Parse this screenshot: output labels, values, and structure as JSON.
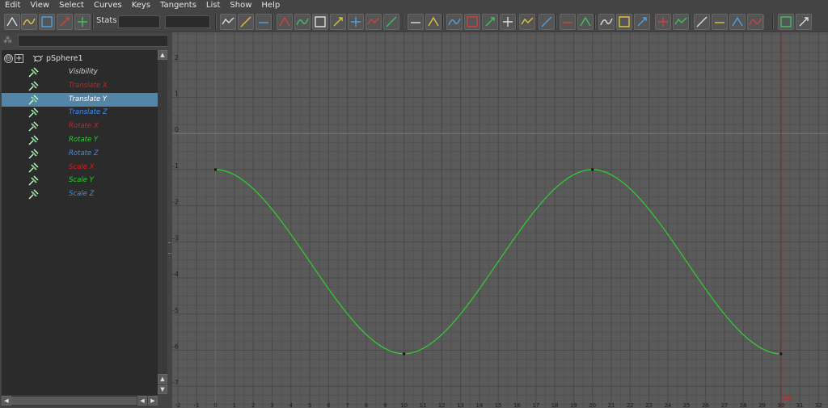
{
  "menubar": {
    "items": [
      "Edit",
      "View",
      "Select",
      "Curves",
      "Keys",
      "Tangents",
      "List",
      "Show",
      "Help"
    ]
  },
  "toolbar": {
    "stats_label": "Stats",
    "tool_icons": [
      "move-key-icon",
      "insert-key-icon",
      "lattice-deform-icon",
      "region-scale-icon",
      "retime-icon",
      "frame-all-icon",
      "frame-playback-range-icon",
      "center-current-time-icon",
      "auto-tangent-icon",
      "spline-tangent-icon",
      "clamped-tangent-icon",
      "linear-tangent-icon",
      "flat-tangent-icon",
      "step-tangent-icon",
      "plateau-tangent-icon",
      "break-tangents-icon",
      "unify-tangents-icon",
      "free-tangent-weight-icon",
      "lock-tangent-weight-icon",
      "weighted-tangents-icon",
      "buffer-curve-snapshot-icon",
      "swap-buffer-curve-icon",
      "auto-load-icon",
      "load-selected-icon",
      "normalize-icon",
      "denormalize-icon",
      "pre-infinity-icon",
      "post-infinity-icon",
      "cycle-icon",
      "cycle-offset-icon",
      "oscillate-icon",
      "linear-infinity-icon",
      "constant-infinity-icon",
      "curve-editor-icon",
      "dope-sheet-icon",
      "trax-editor-icon"
    ]
  },
  "outliner": {
    "root": {
      "name": "pSphere1",
      "expander": "⊖",
      "plus": "+"
    },
    "channels": [
      {
        "label": "Visibility",
        "color": "#d8d8d8"
      },
      {
        "label": "Translate X",
        "color": "#d42020"
      },
      {
        "label": "Translate Y",
        "color": "#ffffff"
      },
      {
        "label": "Translate Z",
        "color": "#3f8cf0"
      },
      {
        "label": "Rotate X",
        "color": "#d42020"
      },
      {
        "label": "Rotate Y",
        "color": "#27d127"
      },
      {
        "label": "Rotate Z",
        "color": "#3f8cf0"
      },
      {
        "label": "Scale X",
        "color": "#d42020"
      },
      {
        "label": "Scale Y",
        "color": "#27d127"
      },
      {
        "label": "Scale Z",
        "color": "#3f8cf0"
      }
    ],
    "selected_channel": "Translate Y",
    "selection_color": "#5285a6"
  },
  "graph_editor": {
    "background": "#5a5a5a",
    "curve_color": "#2fd12f",
    "time_marker_color": "#c01010",
    "current_frame": "30",
    "x_tick_labels": [
      "-2",
      "-1",
      "0",
      "1",
      "2",
      "3",
      "4",
      "5",
      "6",
      "7",
      "8",
      "9",
      "10",
      "11",
      "12",
      "13",
      "14",
      "15",
      "16",
      "17",
      "18",
      "19",
      "20",
      "21",
      "22",
      "23",
      "24",
      "25",
      "26",
      "27",
      "28",
      "29",
      "30",
      "31",
      "32"
    ],
    "y_tick_labels": [
      "2",
      "1",
      "0",
      "-1",
      "-2",
      "-3",
      "-4",
      "-5",
      "-6",
      "-7"
    ],
    "x_range": [
      -2.3,
      32.5
    ],
    "y_range": [
      -7.6,
      2.8
    ]
  },
  "chart_data": {
    "type": "line",
    "title": "",
    "xlabel": "",
    "ylabel": "",
    "x": [
      0,
      10,
      20,
      30
    ],
    "series": [
      {
        "name": "Translate Y",
        "values": [
          -1.0,
          -6.1,
          -1.0,
          -6.1
        ],
        "interpolation": "spline"
      }
    ],
    "xlim": [
      -2,
      32
    ],
    "ylim": [
      -7,
      2
    ],
    "grid": true
  }
}
